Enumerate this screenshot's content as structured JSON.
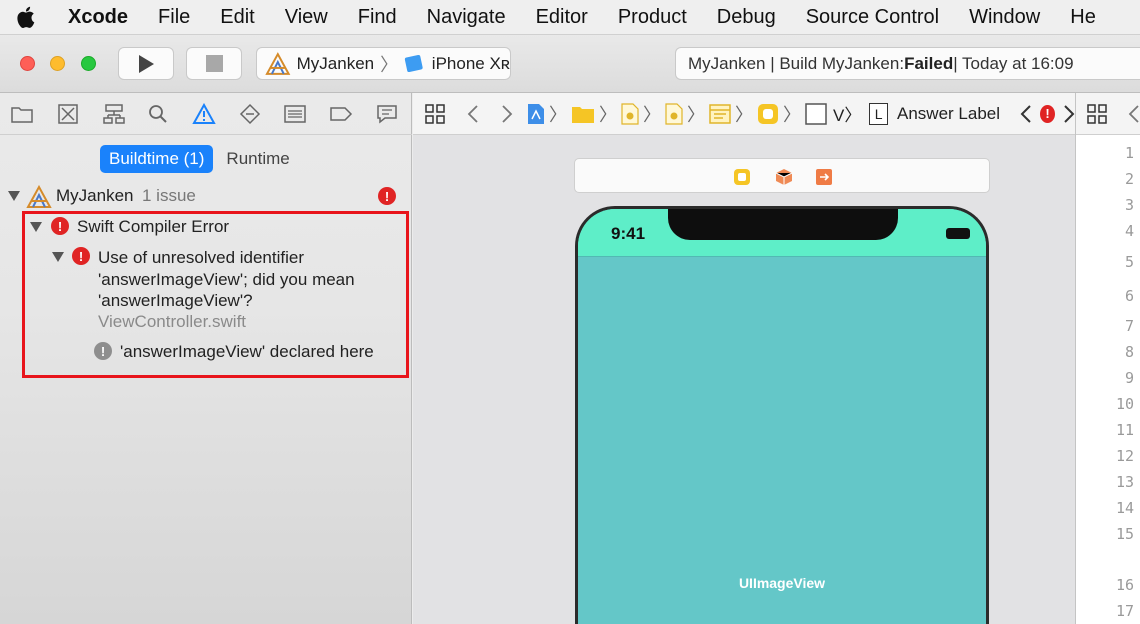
{
  "menubar": {
    "app_name": "Xcode",
    "items": [
      "File",
      "Edit",
      "View",
      "Find",
      "Navigate",
      "Editor",
      "Product",
      "Debug",
      "Source Control",
      "Window",
      "He"
    ]
  },
  "toolbar": {
    "scheme": "MyJanken",
    "separator": "〉",
    "device": "iPhone Xʀ",
    "status_prefix": "MyJanken | Build MyJanken: ",
    "status_result": "Failed",
    "status_suffix": " | Today at 16:09",
    "colors": {
      "close": "#fe5f57",
      "minimize": "#febc2e",
      "zoom": "#28c840"
    }
  },
  "navigator": {
    "tabs": [
      "folder-icon",
      "source-control-icon",
      "hierarchy-icon",
      "search-icon",
      "warning-icon",
      "test-icon",
      "debug-icon",
      "breakpoint-icon",
      "report-icon"
    ],
    "segment": {
      "buildtime": "Buildtime (1)",
      "runtime": "Runtime"
    },
    "project": {
      "name": "MyJanken",
      "issues": "1 issue"
    },
    "error_group": "Swift Compiler Error",
    "error": {
      "line1": "Use of unresolved identifier",
      "line2": "'answerImageView'; did you mean",
      "line3": "'answerImageView'?",
      "file": "ViewController.swift"
    },
    "note": "'answerImageView' declared here",
    "badge": "!"
  },
  "editor": {
    "jump_v": "V〉",
    "jump_l": "L",
    "jump_label": "Answer Label",
    "phone_time": "9:41",
    "image_view_label": "UIImageView"
  },
  "gutter": {
    "lines": [
      "1",
      "2",
      "3",
      "4",
      "5",
      "6",
      "7",
      "8",
      "9",
      "10",
      "11",
      "12",
      "13",
      "14",
      "15",
      "16",
      "17"
    ]
  }
}
